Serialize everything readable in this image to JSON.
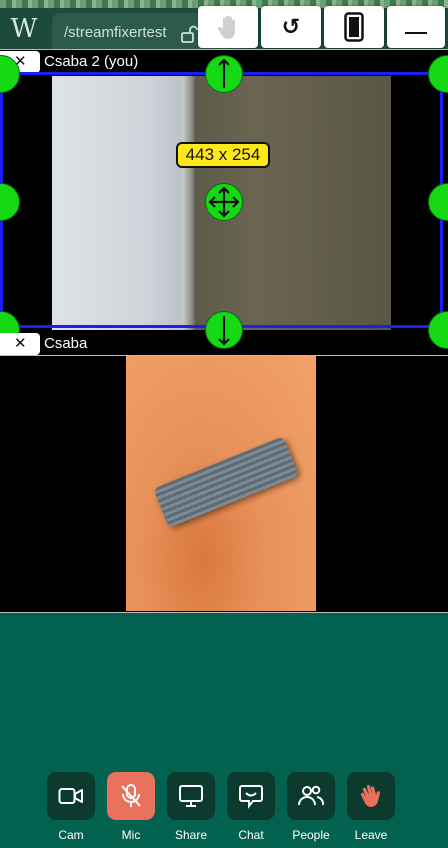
{
  "header": {
    "logo_letter": "W",
    "room_name": "/streamfixertest",
    "buttons": [
      {
        "name": "raise-hand-icon"
      },
      {
        "name": "rotate-icon",
        "glyph": "↺"
      },
      {
        "name": "phone-icon"
      },
      {
        "name": "minimize-icon"
      }
    ]
  },
  "tiles": [
    {
      "name": "Csaba 2 (you)",
      "close": "✕"
    },
    {
      "name": "Csaba",
      "close": "✕"
    }
  ],
  "selection": {
    "size_label": "443 x 254",
    "color": "#1a1ef0",
    "handle_color": "#16d916"
  },
  "controls": [
    {
      "label": "Cam",
      "icon": "camera-icon",
      "active": false
    },
    {
      "label": "Mic",
      "icon": "mic-muted-icon",
      "active": true
    },
    {
      "label": "Share",
      "icon": "screen-share-icon",
      "active": false
    },
    {
      "label": "Chat",
      "icon": "chat-icon",
      "active": false
    },
    {
      "label": "People",
      "icon": "people-icon",
      "active": false
    },
    {
      "label": "Leave",
      "icon": "wave-hand-icon",
      "active": false
    }
  ],
  "colors": {
    "background": "#03624f",
    "control_bg": "#0c3a2f",
    "mic_active": "#e8735a",
    "leave_icon": "#e8735a"
  }
}
